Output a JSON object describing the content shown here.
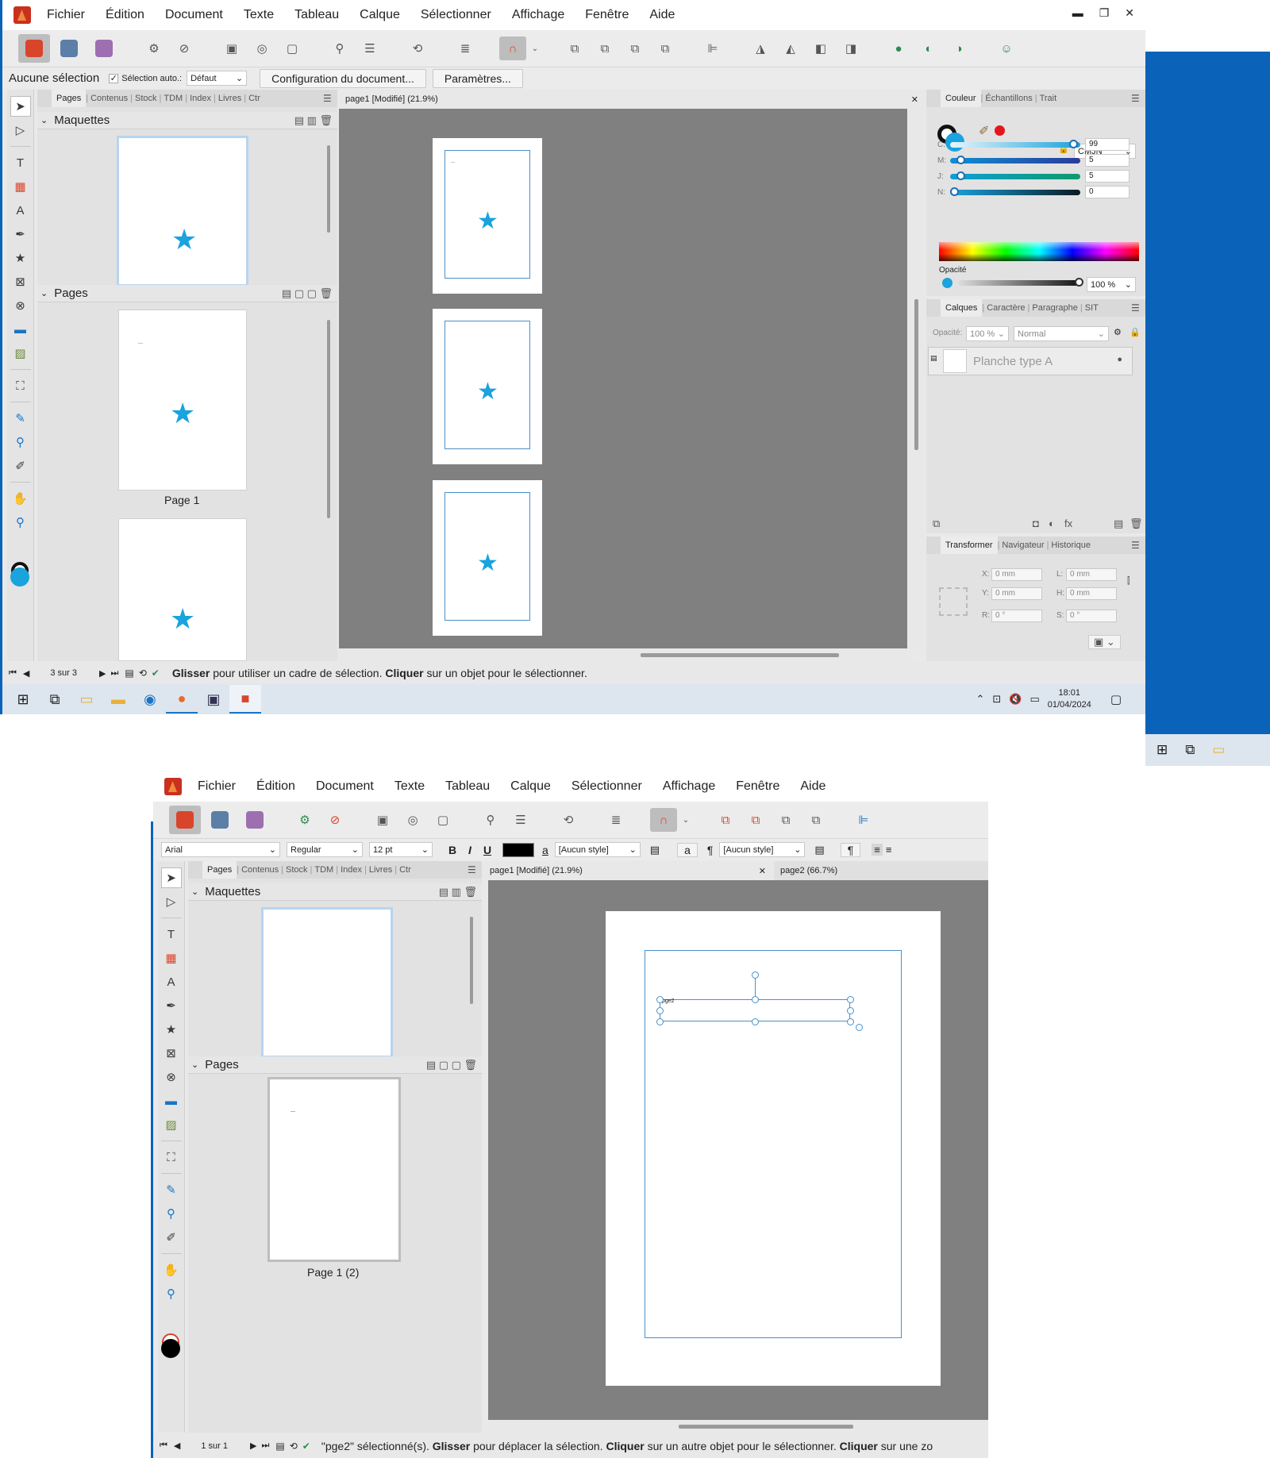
{
  "top_window": {
    "menu": [
      "Fichier",
      "Édition",
      "Document",
      "Texte",
      "Tableau",
      "Calque",
      "Sélectionner",
      "Affichage",
      "Fenêtre",
      "Aide"
    ],
    "context": {
      "selection_label": "Aucune sélection",
      "auto_select_label": "Sélection auto.:",
      "auto_select_value": "Défaut",
      "doc_setup_button": "Configuration du document...",
      "settings_button": "Paramètres..."
    },
    "left_tabs": [
      "Pages",
      "Contenus",
      "Stock",
      "TDM",
      "Index",
      "Livres",
      "Ctr"
    ],
    "masters_title": "Maquettes",
    "pages_title": "Pages",
    "page_label": "Page 1",
    "doc_tab": "page1 [Modifié] (21.9%)",
    "right_tabs_color": [
      "Couleur",
      "Échantillons",
      "Trait"
    ],
    "color_model": "CMJN",
    "color_sliders": [
      {
        "label": "C:",
        "value": "99",
        "level": 0.99
      },
      {
        "label": "M:",
        "value": "5",
        "level": 0.05
      },
      {
        "label": "J:",
        "value": "5",
        "level": 0.05
      },
      {
        "label": "N:",
        "value": "0",
        "level": 0.0
      }
    ],
    "opacity_label": "Opacité",
    "opacity_value": "100 %",
    "layers_tabs": [
      "Calques",
      "Caractère",
      "Paragraphe",
      "SIT"
    ],
    "layers_opacity_label": "Opacité:",
    "layers_opacity_value": "100 %",
    "blend_mode": "Normal",
    "layer_name": "Planche type A",
    "transform_tabs": [
      "Transformer",
      "Navigateur",
      "Historique"
    ],
    "transform_fields": {
      "x_label": "X:",
      "x": "0 mm",
      "y_label": "Y:",
      "y": "0 mm",
      "w_label": "L:",
      "w": "0 mm",
      "h_label": "H:",
      "h": "0 mm",
      "r_label": "R:",
      "r": "0 °",
      "s_label": "S:",
      "s": "0 °"
    },
    "page_counter": "3 sur 3",
    "status_bold1": "Glisser",
    "status_text1": " pour utiliser un cadre de sélection. ",
    "status_bold2": "Cliquer",
    "status_text2": " sur un objet pour le sélectionner.",
    "clock_time": "18:01",
    "clock_date": "01/04/2024",
    "accent": "#1aa3dc"
  },
  "bottom_window": {
    "menu": [
      "Fichier",
      "Édition",
      "Document",
      "Texte",
      "Tableau",
      "Calque",
      "Sélectionner",
      "Affichage",
      "Fenêtre",
      "Aide"
    ],
    "font_family": "Arial",
    "font_style": "Regular",
    "font_size": "12 pt",
    "bold": "B",
    "italic": "I",
    "underline": "U",
    "char_style": "[Aucun style]",
    "para_style": "[Aucun style]",
    "left_tabs": [
      "Pages",
      "Contenus",
      "Stock",
      "TDM",
      "Index",
      "Livres",
      "Ctr"
    ],
    "masters_title": "Maquettes",
    "pages_title": "Pages",
    "page_label": "Page 1 (2)",
    "doc_tab1": "page1 [Modifié] (21.9%)",
    "doc_tab2": "page2 (66.7%)",
    "frame_text": "pge2",
    "page_counter": "1 sur 1",
    "status_text0": "\"pge2\" sélectionné(s). ",
    "status_bold1": "Glisser",
    "status_text1": " pour déplacer la sélection. ",
    "status_bold2": "Cliquer",
    "status_text2": " sur un autre objet pour le sélectionner. ",
    "status_bold3": "Cliquer",
    "status_text3": " sur une zo"
  }
}
